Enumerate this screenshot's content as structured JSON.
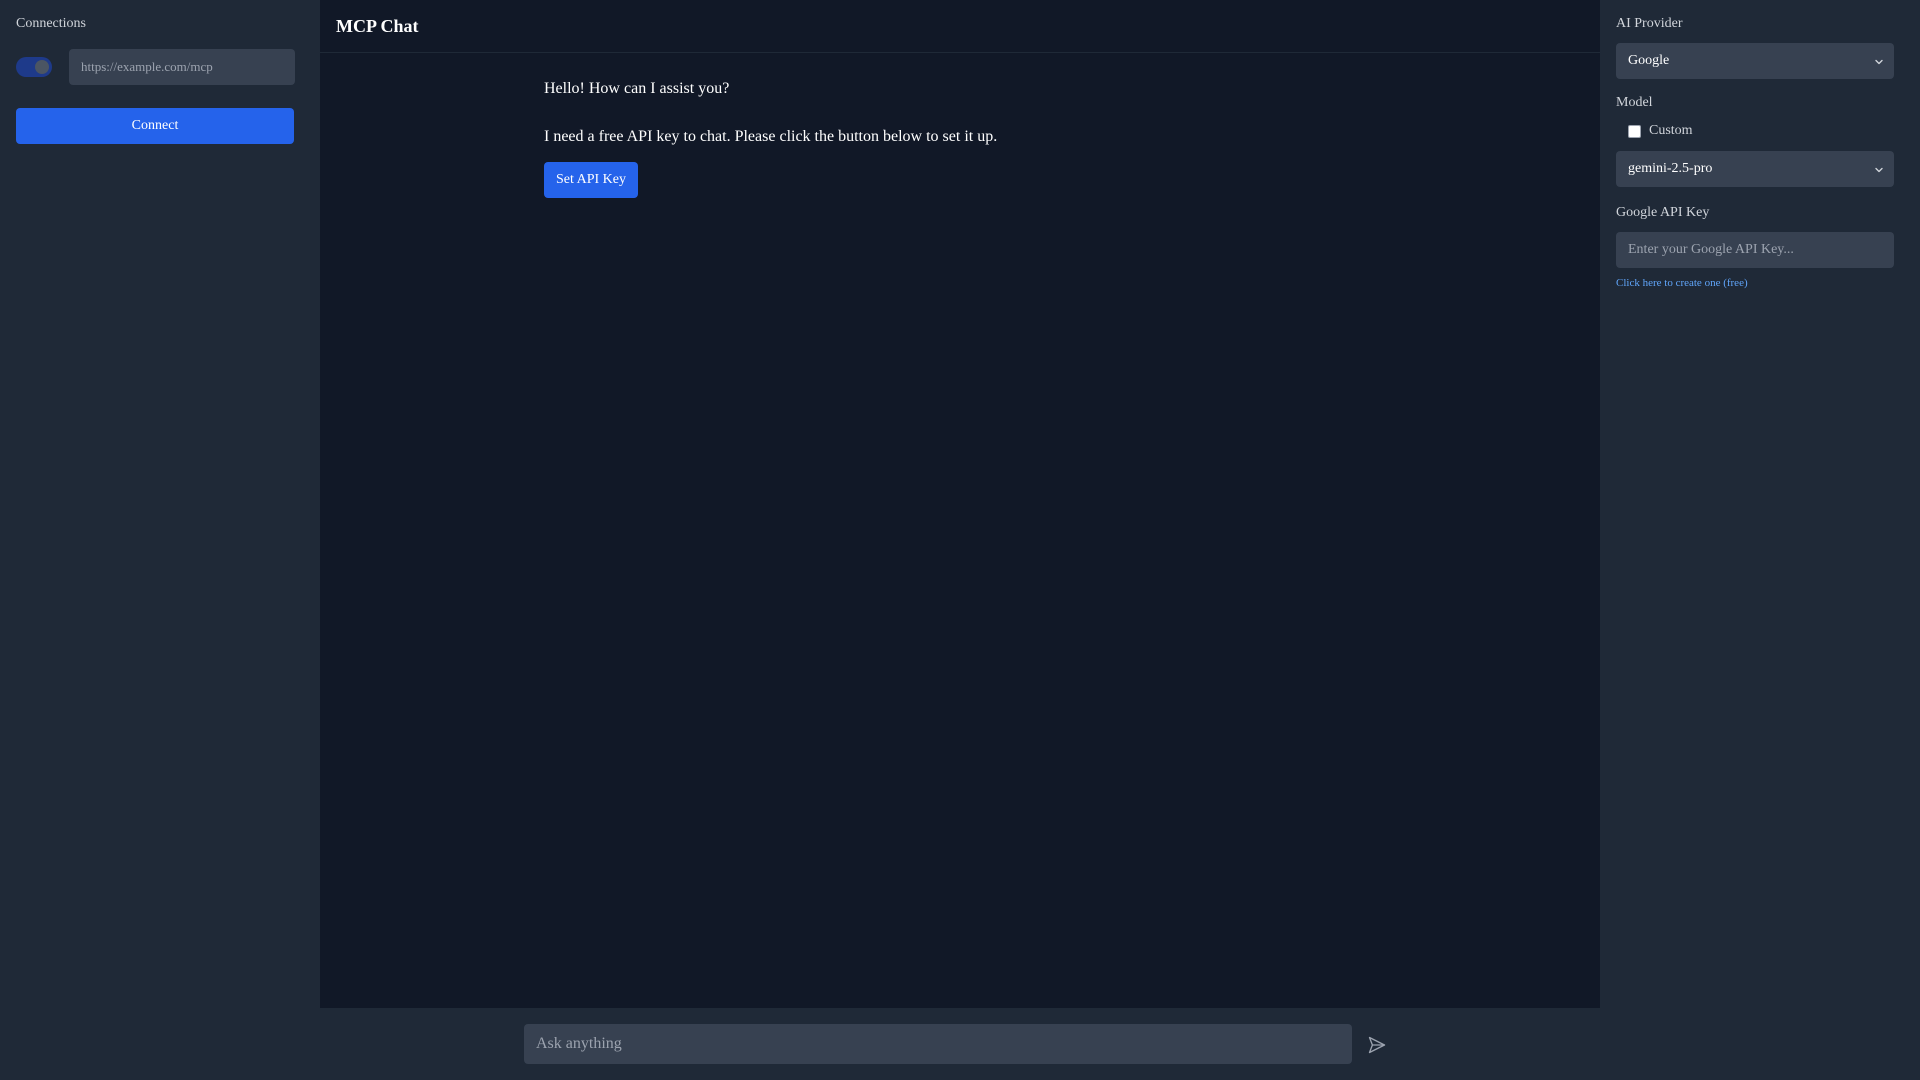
{
  "left_sidebar": {
    "title": "Connections",
    "url_placeholder": "https://example.com/mcp",
    "toggle_on": true,
    "connect_label": "Connect"
  },
  "header": {
    "title": "MCP Chat"
  },
  "messages": [
    {
      "text": "Hello! How can I assist you?"
    },
    {
      "text": "I need a free API key to chat. Please click the button below to set it up."
    }
  ],
  "set_api_key_label": "Set API Key",
  "chat": {
    "placeholder": "Ask anything"
  },
  "right_sidebar": {
    "provider_label": "AI Provider",
    "provider_value": "Google",
    "model_label": "Model",
    "custom_label": "Custom",
    "custom_checked": false,
    "model_value": "gemini-2.5-pro",
    "api_key_label": "Google API Key",
    "api_key_placeholder": "Enter your Google API Key...",
    "create_link": "Click here to create one (free)"
  },
  "colors": {
    "accent": "#2563eb",
    "link": "#60a5fa",
    "panel_bg": "#1f2937",
    "main_bg": "#111827"
  },
  "icons": {
    "send": "send-icon",
    "chevron": "chevron-down-icon"
  }
}
